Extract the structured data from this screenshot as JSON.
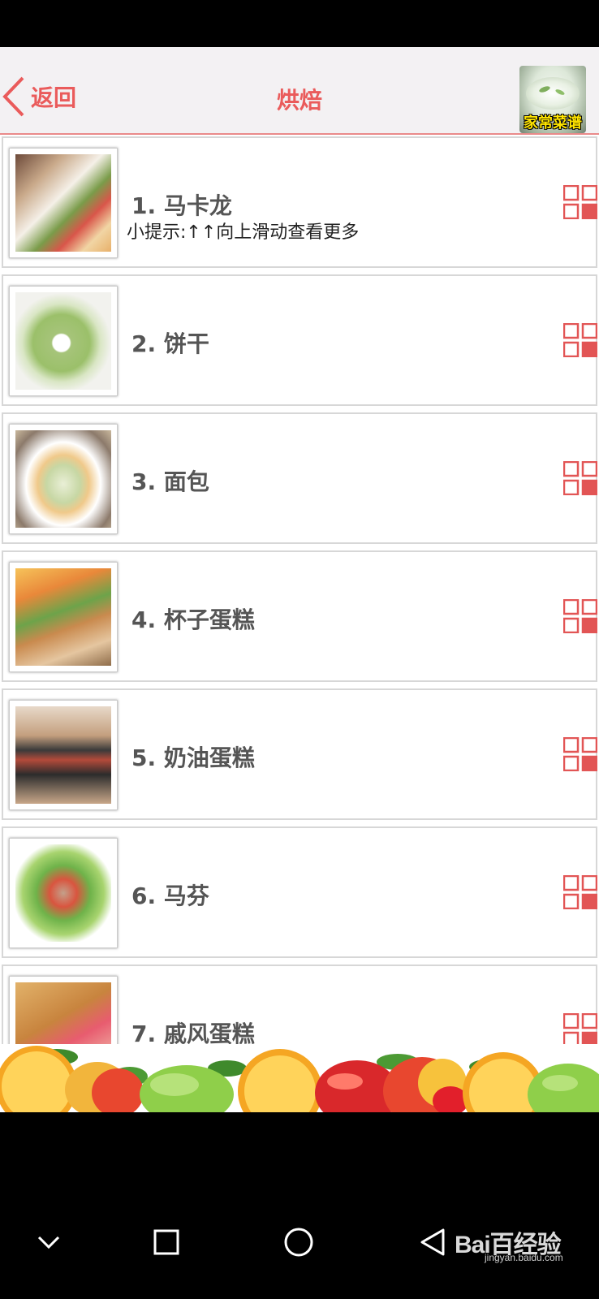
{
  "header": {
    "back_label": "返回",
    "title": "烘焙",
    "logo_text": "家常菜谱"
  },
  "list": {
    "items": [
      {
        "title": "1. 马卡龙",
        "tip": "小提示:↑↑向上滑动查看更多"
      },
      {
        "title": "2. 饼干"
      },
      {
        "title": "3. 面包"
      },
      {
        "title": "4. 杯子蛋糕"
      },
      {
        "title": "5. 奶油蛋糕"
      },
      {
        "title": "6. 马芬"
      },
      {
        "title": "7. 戚风蛋糕"
      }
    ]
  },
  "nav": {
    "watermark": "Bai百经验",
    "watermark_sub": "jingyan.baidu.com"
  },
  "colors": {
    "accent": "#ea5b5b",
    "header_bg": "#f3f1f3",
    "row_border": "#d7d7d7",
    "title_text": "#555555"
  },
  "icons": [
    "chevron-left-icon",
    "grid-icon",
    "nav-down-icon",
    "nav-recents-icon",
    "nav-home-icon",
    "nav-back-icon"
  ]
}
